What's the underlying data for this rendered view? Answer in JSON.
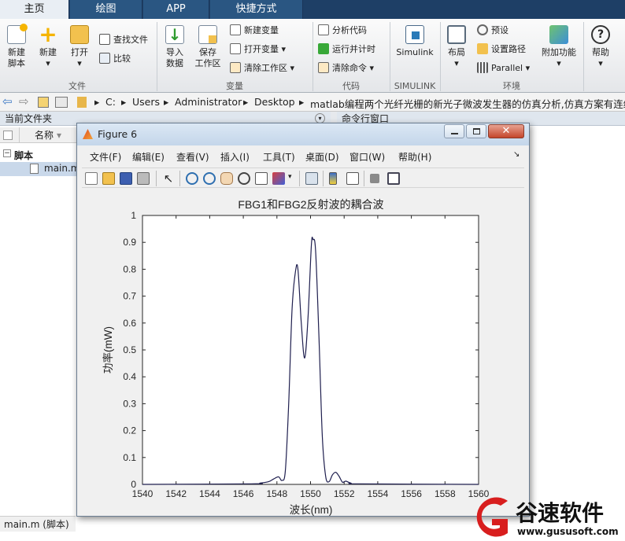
{
  "tabs": [
    "主页",
    "绘图",
    "APP",
    "快捷方式"
  ],
  "ribbon": {
    "file": {
      "new_script": "新建\n脚本",
      "new": "新建",
      "open": "打开",
      "find_files": "查找文件",
      "compare": "比较",
      "group": "文件"
    },
    "variable": {
      "import": "导入\n数据",
      "save_ws": "保存\n工作区",
      "new_var": "新建变量",
      "open_var": "打开变量",
      "clear_ws": "清除工作区",
      "group": "变量"
    },
    "code": {
      "analyze": "分析代码",
      "run_time": "运行并计时",
      "clear_cmd": "清除命令",
      "group": "代码"
    },
    "simulink": {
      "label": "Simulink",
      "group": "SIMULINK"
    },
    "env": {
      "layout": "布局",
      "prefs": "预设",
      "set_path": "设置路径",
      "parallel": "Parallel",
      "addons": "附加功能",
      "group": "环境"
    },
    "help": "帮助"
  },
  "address": {
    "drive": "C:",
    "users": "Users",
    "admin": "Administrator",
    "desktop": "Desktop",
    "folder": "matlab编程两个光纤光栅的新光子微波发生器的仿真分析,仿真方案有连续波"
  },
  "left_panel": {
    "title": "当前文件夹",
    "col_name": "名称",
    "group": "脚本",
    "file": "main.m"
  },
  "command_window": {
    "title": "命令行窗口"
  },
  "footer": {
    "label": "main.m  (脚本)"
  },
  "figure": {
    "title": "Figure 6",
    "menu": [
      "文件(F)",
      "编辑(E)",
      "查看(V)",
      "插入(I)",
      "工具(T)",
      "桌面(D)",
      "窗口(W)",
      "帮助(H)"
    ]
  },
  "chart_data": {
    "type": "line",
    "title": "FBG1和FBG2反射波的耦合波",
    "xlabel": "波长(nm)",
    "ylabel": "功率(mW)",
    "xlim": [
      1540,
      1560
    ],
    "ylim": [
      0,
      1
    ],
    "xticks": [
      1540,
      1542,
      1544,
      1546,
      1548,
      1550,
      1552,
      1554,
      1556,
      1558,
      1560
    ],
    "yticks": [
      0,
      0.1,
      0.2,
      0.3,
      0.4,
      0.5,
      0.6,
      0.7,
      0.8,
      0.9,
      1
    ],
    "series": [
      {
        "color": "#1f1f4f",
        "x": [
          1540,
          1546.5,
          1547.0,
          1547.5,
          1547.8,
          1548.1,
          1548.3,
          1548.5,
          1548.7,
          1548.9,
          1549.1,
          1549.25,
          1549.45,
          1549.65,
          1549.85,
          1550.05,
          1550.15,
          1550.3,
          1550.5,
          1550.7,
          1550.9,
          1551.1,
          1551.3,
          1551.5,
          1551.7,
          1551.9,
          1552.1,
          1552.4,
          1553,
          1560
        ],
        "y": [
          0,
          0.002,
          0.005,
          0.01,
          0.02,
          0.028,
          0.015,
          0.05,
          0.3,
          0.65,
          0.79,
          0.8,
          0.6,
          0.47,
          0.62,
          0.89,
          0.91,
          0.87,
          0.55,
          0.18,
          0.03,
          0.01,
          0.035,
          0.045,
          0.03,
          0.008,
          0.012,
          0.005,
          0.002,
          0
        ]
      }
    ]
  },
  "watermark": {
    "brand": "谷速软件",
    "url": "www.gususoft.com"
  },
  "colors": {
    "accent": "#1e3f66",
    "plot_line": "#1f1f4f",
    "logo_red": "#d81e1e"
  }
}
